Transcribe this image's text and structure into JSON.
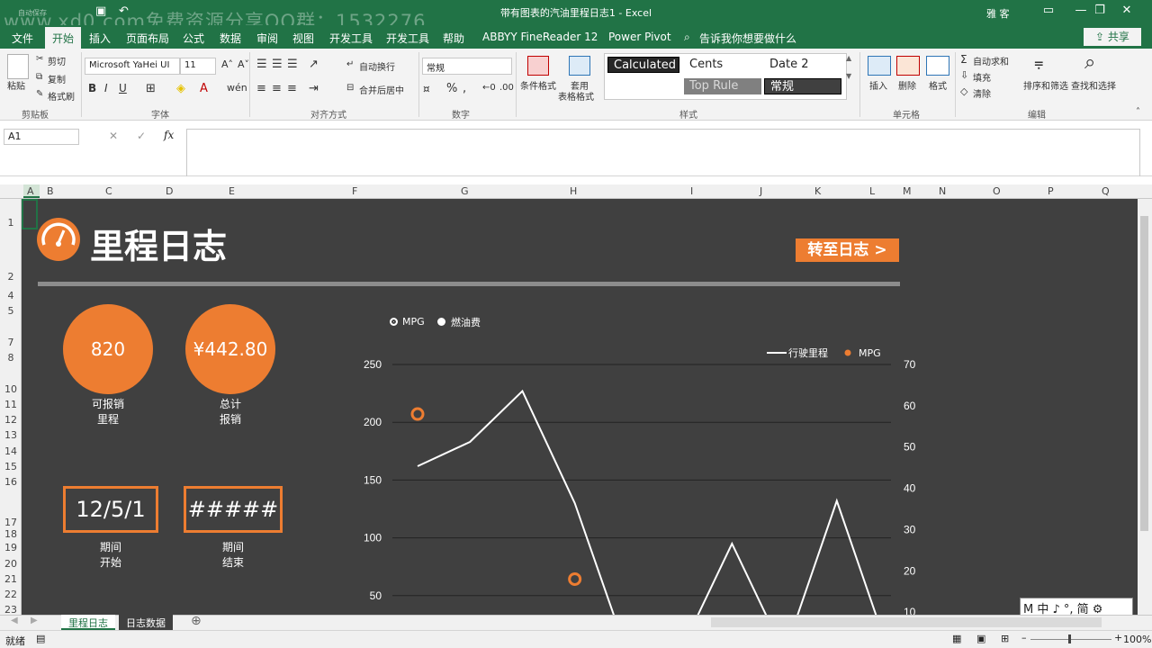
{
  "titlebar": {
    "title": "带有图表的汽油里程日志1  -  Excel",
    "user": "雅 客",
    "autosave": "自动保存",
    "watermark": "www.xd0.com免费资源分享QQ群：1532276"
  },
  "ribbon_tabs": [
    "文件",
    "开始",
    "插入",
    "页面布局",
    "公式",
    "数据",
    "审阅",
    "视图",
    "开发工具",
    "开发工具",
    "帮助",
    "ABBYY FineReader 12",
    "Power Pivot"
  ],
  "tell_me": "告诉我你想要做什么",
  "share": "共享",
  "clipboard": {
    "paste": "粘贴",
    "cut": "剪切",
    "copy": "复制",
    "format_painter": "格式刷",
    "label": "剪贴板"
  },
  "font": {
    "name": "Microsoft YaHei UI",
    "size": "11",
    "label": "字体"
  },
  "alignment": {
    "wrap": "自动换行",
    "merge": "合并后居中",
    "label": "对齐方式"
  },
  "number": {
    "format": "常规",
    "label": "数字"
  },
  "styles": {
    "conditional": "条件格式",
    "table_fmt_1": "套用",
    "table_fmt_2": "表格格式",
    "gallery": [
      "Calculated",
      "Cents",
      "Date 2",
      "Top Rule",
      "常规"
    ],
    "label": "样式"
  },
  "cells": {
    "insert": "插入",
    "delete": "删除",
    "format": "格式",
    "label": "单元格"
  },
  "editing": {
    "autosum": "自动求和",
    "fill": "填充",
    "clear": "清除",
    "sort": "排序和筛选",
    "find": "查找和选择",
    "label": "编辑"
  },
  "formula_bar": {
    "namebox": "A1",
    "fx": "fx",
    "cancel": "✕",
    "enter": "✓",
    "content": ""
  },
  "columns": [
    "A",
    "B",
    "C",
    "D",
    "E",
    "F",
    "G",
    "H",
    "I",
    "J",
    "K",
    "L",
    "M",
    "N",
    "O",
    "P",
    "Q"
  ],
  "rows": [
    "1",
    "2",
    "4",
    "5",
    "7",
    "8",
    "10",
    "11",
    "12",
    "13",
    "14",
    "15",
    "16",
    "17",
    "18",
    "19",
    "20",
    "21",
    "22",
    "23"
  ],
  "dashboard": {
    "title": "里程日志",
    "goto_button": "转至日志 >",
    "kpis": [
      {
        "value": "820",
        "label1": "可报销",
        "label2": "里程"
      },
      {
        "value": "¥442.80",
        "label1": "总计",
        "label2": "报销"
      }
    ],
    "boxes": [
      {
        "value": "12/5/1",
        "label1": "期间",
        "label2": "开始"
      },
      {
        "value": "#####",
        "label1": "期间",
        "label2": "结束"
      }
    ],
    "toggle": [
      "MPG",
      "燃油费"
    ]
  },
  "chart_data": {
    "type": "line",
    "title": "",
    "legend": [
      "行驶里程",
      "MPG"
    ],
    "legend_position": "top-right",
    "y_left": {
      "min": 0,
      "max": 250,
      "ticks": [
        50,
        100,
        150,
        200,
        250
      ]
    },
    "y_right": {
      "min": 0,
      "max": 70,
      "ticks": [
        10,
        20,
        30,
        40,
        50,
        60,
        70
      ]
    },
    "series": [
      {
        "name": "行驶里程",
        "axis": "left",
        "color": "#ffffff",
        "values": [
          162,
          183,
          227,
          130,
          0,
          0,
          95,
          0,
          132,
          0
        ]
      },
      {
        "name": "MPG",
        "axis": "right",
        "color": "#ED7D31",
        "marker": "circle",
        "values": [
          58,
          null,
          null,
          18
        ]
      }
    ],
    "grid": true
  },
  "sheet_tabs": [
    "里程日志",
    "日志数据"
  ],
  "status": {
    "ready": "就绪",
    "zoom": "100%"
  },
  "ime": "M 中 ♪ °, 简 ⚙"
}
